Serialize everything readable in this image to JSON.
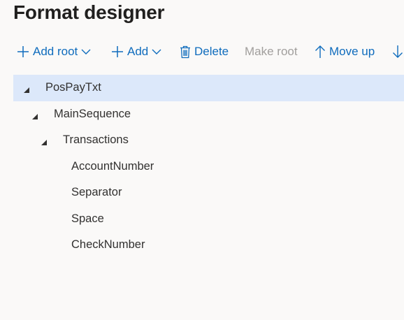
{
  "page": {
    "title": "Format designer"
  },
  "toolbar": {
    "add_root_label": "Add root",
    "add_label": "Add",
    "delete_label": "Delete",
    "make_root_label": "Make root",
    "move_up_label": "Move up",
    "add_root_icon": "plus-icon",
    "add_icon": "plus-icon",
    "delete_icon": "trash-icon",
    "move_up_icon": "arrow-up-icon",
    "move_down_icon": "arrow-down-icon",
    "dropdown_icon": "chevron-down-icon",
    "make_root_enabled": false
  },
  "tree": {
    "selected_index": 0,
    "nodes": [
      {
        "label": "PosPayTxt",
        "depth": 0,
        "expanded": true
      },
      {
        "label": "MainSequence",
        "depth": 1,
        "expanded": true
      },
      {
        "label": "Transactions",
        "depth": 2,
        "expanded": true
      },
      {
        "label": "AccountNumber",
        "depth": 3
      },
      {
        "label": "Separator",
        "depth": 3
      },
      {
        "label": "Space",
        "depth": 3
      },
      {
        "label": "CheckNumber",
        "depth": 3
      }
    ]
  },
  "colors": {
    "accent": "#0f6cbd",
    "disabled": "#a19f9d",
    "selection": "#dce8fa",
    "background": "#faf9f8"
  }
}
